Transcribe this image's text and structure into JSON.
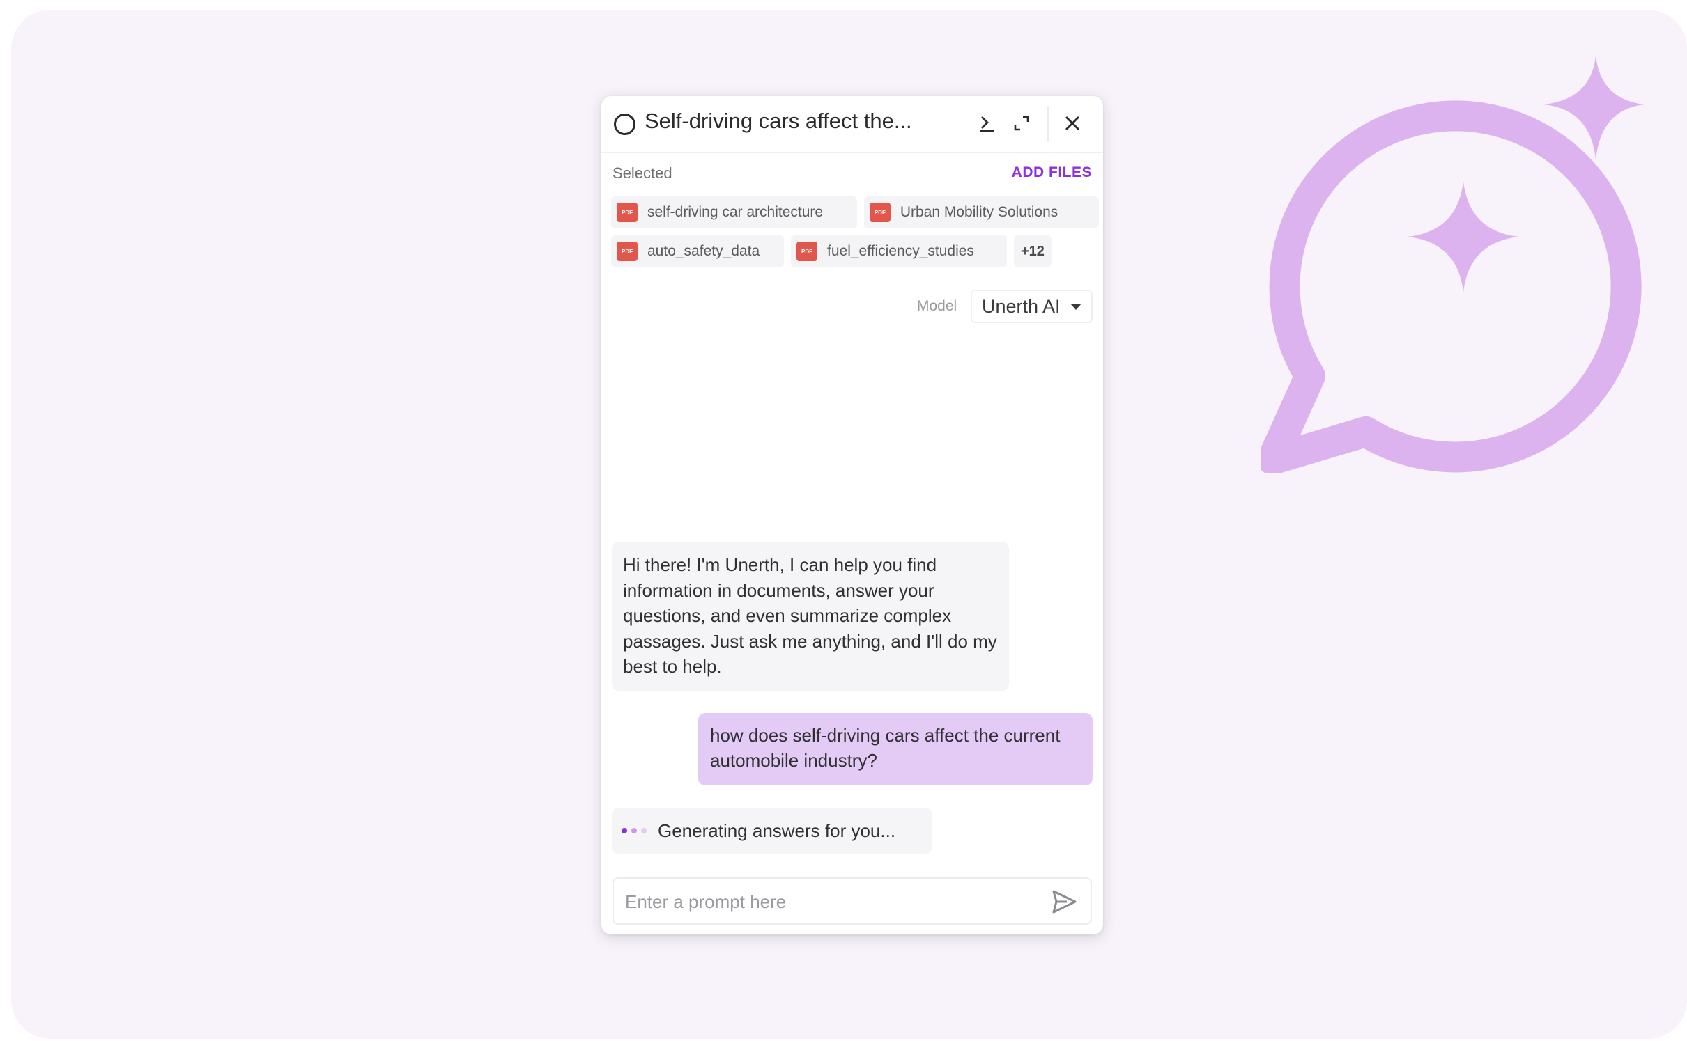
{
  "chat": {
    "title": "Self-driving cars affect the...",
    "selected_label": "Selected",
    "add_files_label": "ADD FILES",
    "files_row1": [
      "self-driving car architecture",
      "Urban Mobility Solutions"
    ],
    "files_row2": [
      "auto_safety_data",
      "fuel_efficiency_studies"
    ],
    "file_icon_label": "PDF",
    "more_files": "+12",
    "model_label": "Model",
    "model_value": "Unerth AI",
    "messages": {
      "bot_greeting": "Hi there! I'm Unerth, I can help you find information in documents, answer your questions, and even summarize complex passages. Just ask me anything, and I'll do my best to help.",
      "user_question": "how does self-driving cars affect the current automobile industry?",
      "generating": "Generating answers for you..."
    },
    "prompt_placeholder": "Enter a prompt here"
  },
  "icons": {
    "status": "circle-status-icon",
    "download": "download-icon",
    "expand": "expand-icon",
    "close": "close-icon",
    "file": "pdf-file-icon",
    "caret": "caret-down-icon",
    "send": "send-icon",
    "illustration": "chat-sparkle-icon"
  },
  "colors": {
    "accent": "#8b2fe0",
    "user_bubble": "#e3cbf5",
    "bot_bubble": "#f5f5f7",
    "pdf_red": "#e2574c",
    "illustration": "#dcb3ee",
    "background": "#f8f3fb"
  }
}
